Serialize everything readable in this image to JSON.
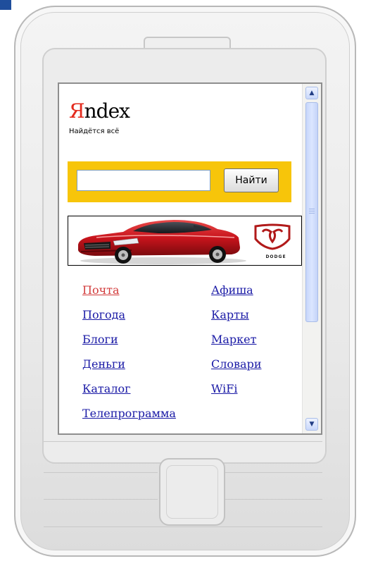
{
  "logo": {
    "ya": "Я",
    "rest": "ndex",
    "tagline": "Найдётся всё"
  },
  "search": {
    "value": "",
    "placeholder": "",
    "button_label": "Найти"
  },
  "banner": {
    "brand": "DODGE"
  },
  "links": {
    "left": [
      "Почта",
      "Погода",
      "Блоги",
      "Деньги",
      "Каталог",
      "Телепрограмма"
    ],
    "right": [
      "Афиша",
      "Карты",
      "Маркет",
      "Словари",
      "WiFi"
    ]
  },
  "colors": {
    "logo_red": "#e32b1e",
    "search_bar": "#f7c50a",
    "link": "#1a1aa6",
    "visited_link": "#d23a3a"
  },
  "icons": {
    "scroll_up": "triangle-up",
    "scroll_down": "triangle-down",
    "brand_logo": "ram-head"
  }
}
